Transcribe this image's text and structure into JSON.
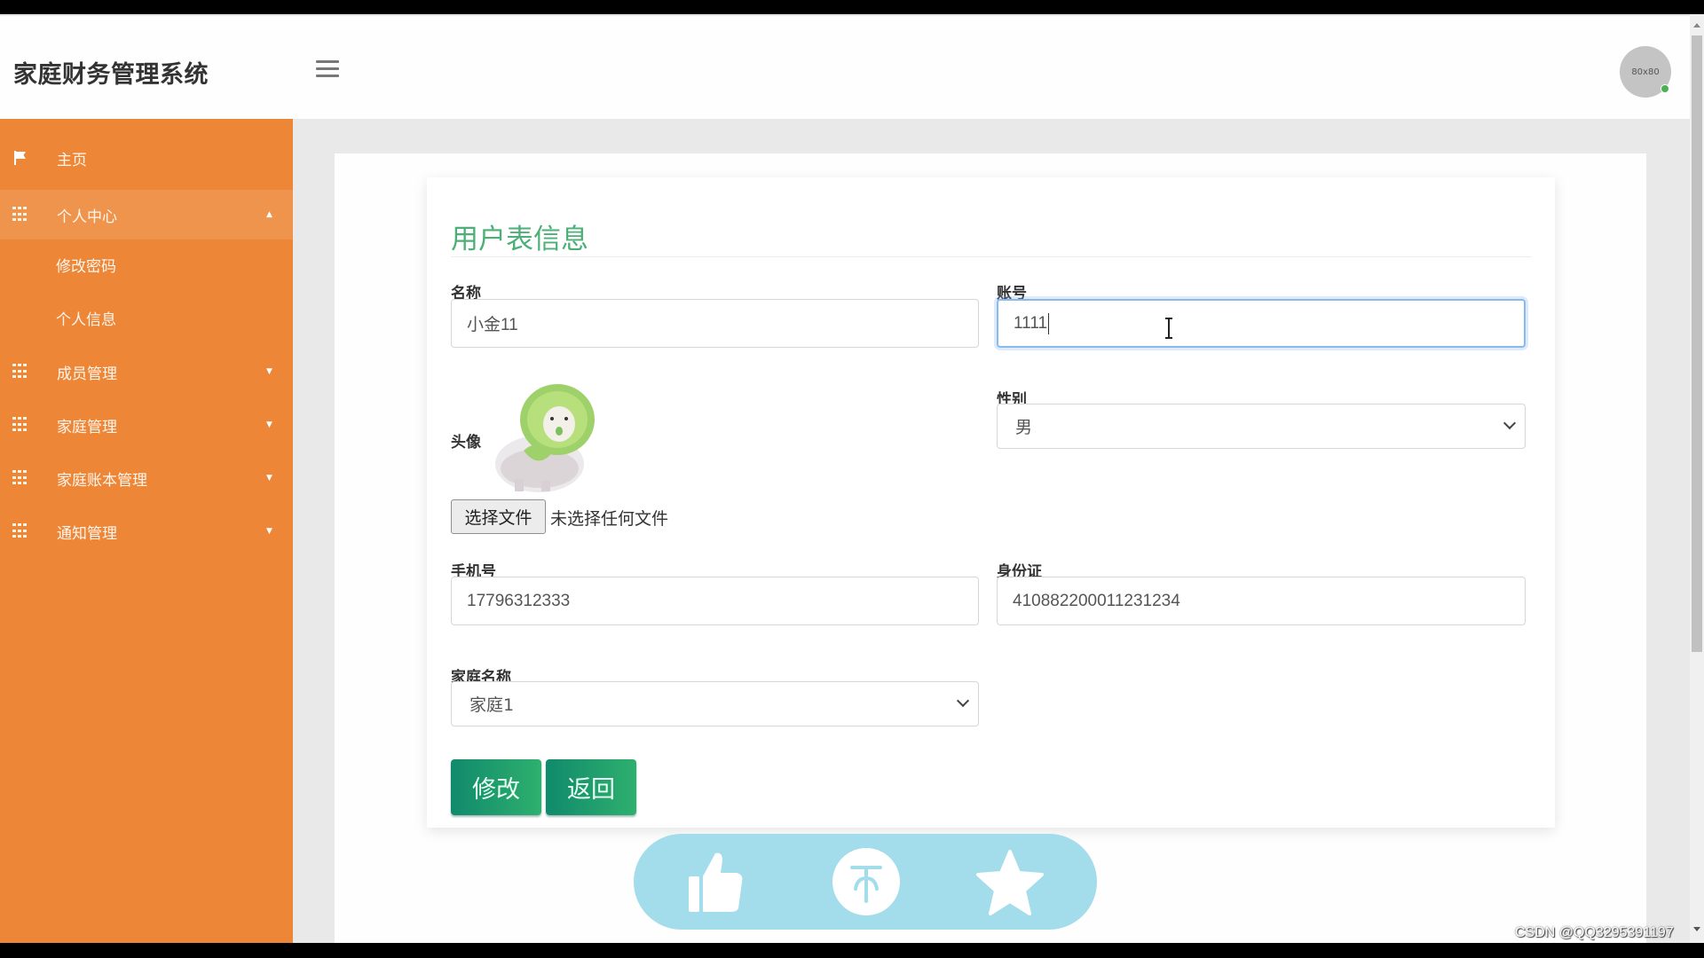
{
  "header": {
    "app_title": "家庭财务管理系统",
    "avatar_text": "80x80"
  },
  "sidebar": {
    "items": [
      {
        "label": "主页",
        "icon": "flag-icon"
      },
      {
        "label": "个人中心",
        "icon": "grid-icon",
        "expanded": true
      },
      {
        "label": "修改密码"
      },
      {
        "label": "个人信息"
      },
      {
        "label": "成员管理",
        "icon": "grid-icon",
        "expanded": false
      },
      {
        "label": "家庭管理",
        "icon": "grid-icon",
        "expanded": false
      },
      {
        "label": "家庭账本管理",
        "icon": "grid-icon",
        "expanded": false
      },
      {
        "label": "通知管理",
        "icon": "grid-icon",
        "expanded": false
      }
    ]
  },
  "form": {
    "title": "用户表信息",
    "name_label": "名称",
    "name_value": "小金11",
    "account_label": "账号",
    "account_value": "1111",
    "avatar_label": "头像",
    "file_button": "选择文件",
    "file_status": "未选择任何文件",
    "gender_label": "性别",
    "gender_value": "男",
    "phone_label": "手机号",
    "phone_value": "17796312333",
    "idcard_label": "身份证",
    "idcard_value": "410882200011231234",
    "family_label": "家庭名称",
    "family_value": "家庭1",
    "submit_label": "修改",
    "back_label": "返回"
  },
  "floating_actions": [
    "like-icon",
    "coin-icon",
    "star-icon"
  ],
  "colors": {
    "sidebar": "#ed8636",
    "title_green": "#4caf78",
    "button_green": "#1a9a6c",
    "pill": "#a3dcea"
  },
  "watermark": "CSDN @QQ3295391197"
}
